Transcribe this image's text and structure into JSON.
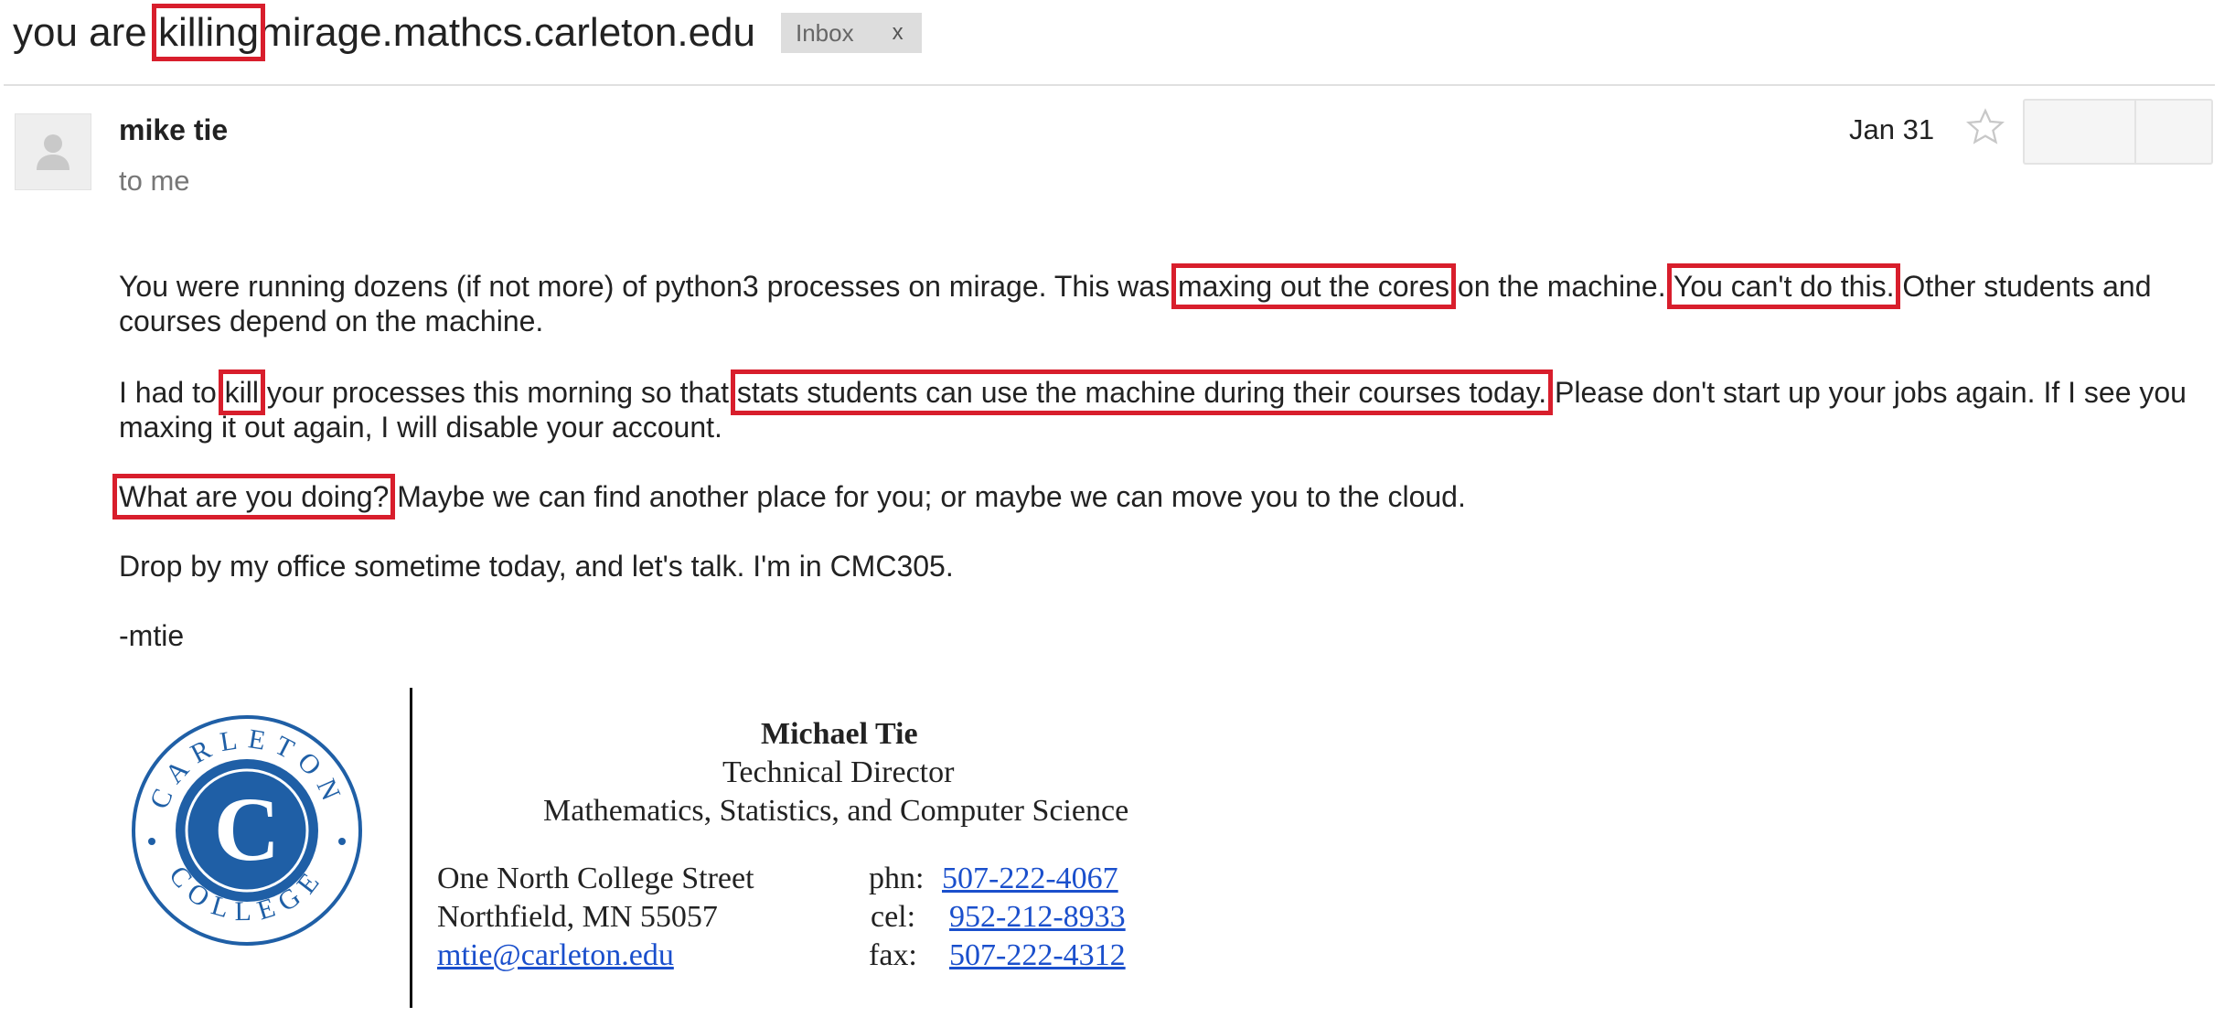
{
  "header": {
    "subject_prefix": "you are",
    "subject_highlight": "killing",
    "subject_suffix": "mirage.mathcs.carleton.edu",
    "label_tag": "Inbox",
    "label_close": "x"
  },
  "message": {
    "sender_name": "mike tie",
    "recipient": "to me",
    "date": "Jan 31",
    "paragraphs": {
      "p1": {
        "a": "You were running dozens (if not more) of python3 processes on mirage.  This was",
        "h1": "maxing out the cores",
        "b": "on the machine. ",
        "h2": "You can't do this.",
        "c": " Other students and courses depend on the machine."
      },
      "p2": {
        "a": "I had to",
        "h1": "kill",
        "b": "your processes this morning so that",
        "h2": "stats students can use the machine during their courses today.",
        "c": " Please don't start up your jobs again.  If I see you maxing it out again, I will disable your account."
      },
      "p3": {
        "h1": "What are you doing?",
        "a": " Maybe we can find another place for you;  or maybe we can move you to the cloud."
      },
      "p4": "Drop by my office sometime today, and let's talk.  I'm in CMC305.",
      "p5": "-mtie"
    }
  },
  "signature": {
    "logo_text_top": "CARLETON",
    "logo_text_bottom": "COLLEGE",
    "logo_letter": "C",
    "name": "Michael Tie",
    "title": "Technical Director",
    "department": "Mathematics, Statistics, and Computer Science",
    "address_line1": "One North College Street",
    "address_line2": "Northfield, MN 55057",
    "email": "mtie@carleton.edu",
    "phone_label": "phn:",
    "phone": "507-222-4067",
    "cell_label": "cel:",
    "cell": "952-212-8933",
    "fax_label": "fax:",
    "fax": "507-222-4312"
  },
  "colors": {
    "highlight_box": "#d81e2c",
    "link": "#1a4fcc",
    "logo_blue": "#1f5fa6"
  },
  "icons": {
    "avatar": "person-placeholder-icon",
    "star": "star-outline-icon"
  }
}
